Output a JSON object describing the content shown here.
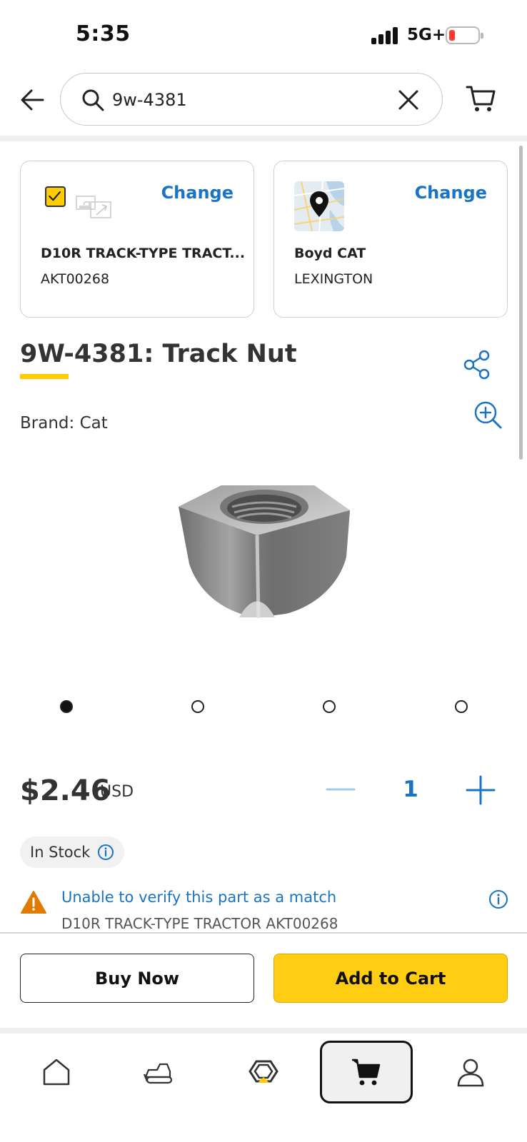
{
  "status_bar": {
    "time": "5:35",
    "network": "5G+"
  },
  "search": {
    "query": "9w-4381"
  },
  "equipment_card": {
    "change_label": "Change",
    "name": "D10R TRACK-TYPE TRACT...",
    "serial": "AKT00268"
  },
  "dealer_card": {
    "change_label": "Change",
    "name": "Boyd CAT",
    "location": "LEXINGTON"
  },
  "product": {
    "title": "9W-4381: Track Nut",
    "brand": "Brand: Cat",
    "price": "$2.46",
    "currency": "USD",
    "quantity": "1",
    "stock": "In Stock",
    "image_index": 1,
    "image_count": 4
  },
  "warning": {
    "message": "Unable to verify this part as a match",
    "detail": "D10R TRACK-TYPE TRACTOR AKT00268"
  },
  "actions": {
    "buy_now": "Buy Now",
    "add_to_cart": "Add to Cart"
  },
  "bottom_nav": {
    "items": [
      "home-icon",
      "equipment-icon",
      "cat-logo-icon",
      "cart-icon",
      "profile-icon"
    ],
    "active": "cart-icon"
  },
  "colors": {
    "accent": "#1a73c4",
    "brand_yellow": "#ffcd11",
    "warning": "#e07b00"
  }
}
